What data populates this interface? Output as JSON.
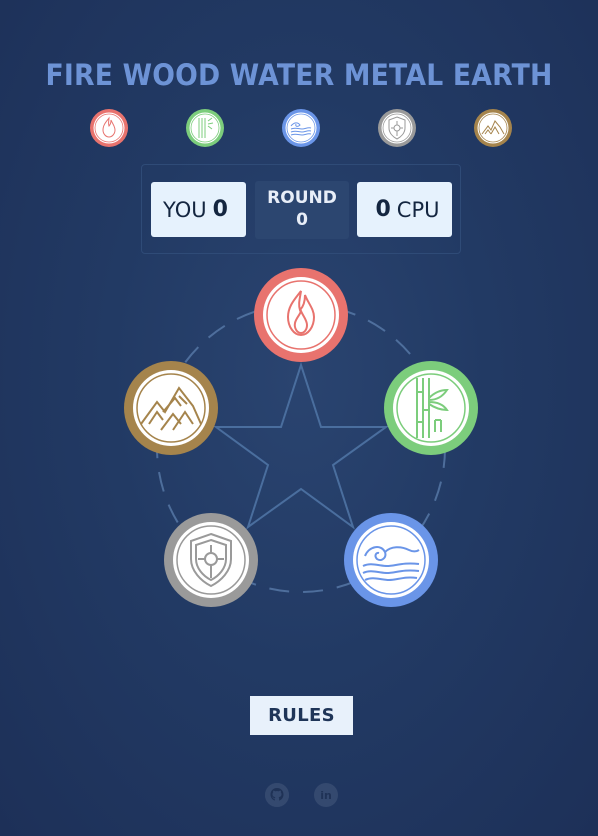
{
  "title": "FIRE WOOD WATER METAL EARTH",
  "elements": [
    {
      "name": "fire",
      "icon": "flame-icon",
      "color": "#e8736e"
    },
    {
      "name": "wood",
      "icon": "bamboo-icon",
      "color": "#7ccd7c"
    },
    {
      "name": "water",
      "icon": "waves-icon",
      "color": "#6a95e8"
    },
    {
      "name": "metal",
      "icon": "shield-icon",
      "color": "#9a9a9a"
    },
    {
      "name": "earth",
      "icon": "mountains-icon",
      "color": "#a5844c"
    }
  ],
  "score": {
    "you_label": "YOU",
    "you_value": "0",
    "round_label": "ROUND",
    "round_value": "0",
    "cpu_label": "CPU",
    "cpu_value": "0"
  },
  "rules_button": "RULES",
  "footer": {
    "github_icon": "github-icon",
    "linkedin_icon": "linkedin-icon",
    "linkedin_text": "in"
  }
}
